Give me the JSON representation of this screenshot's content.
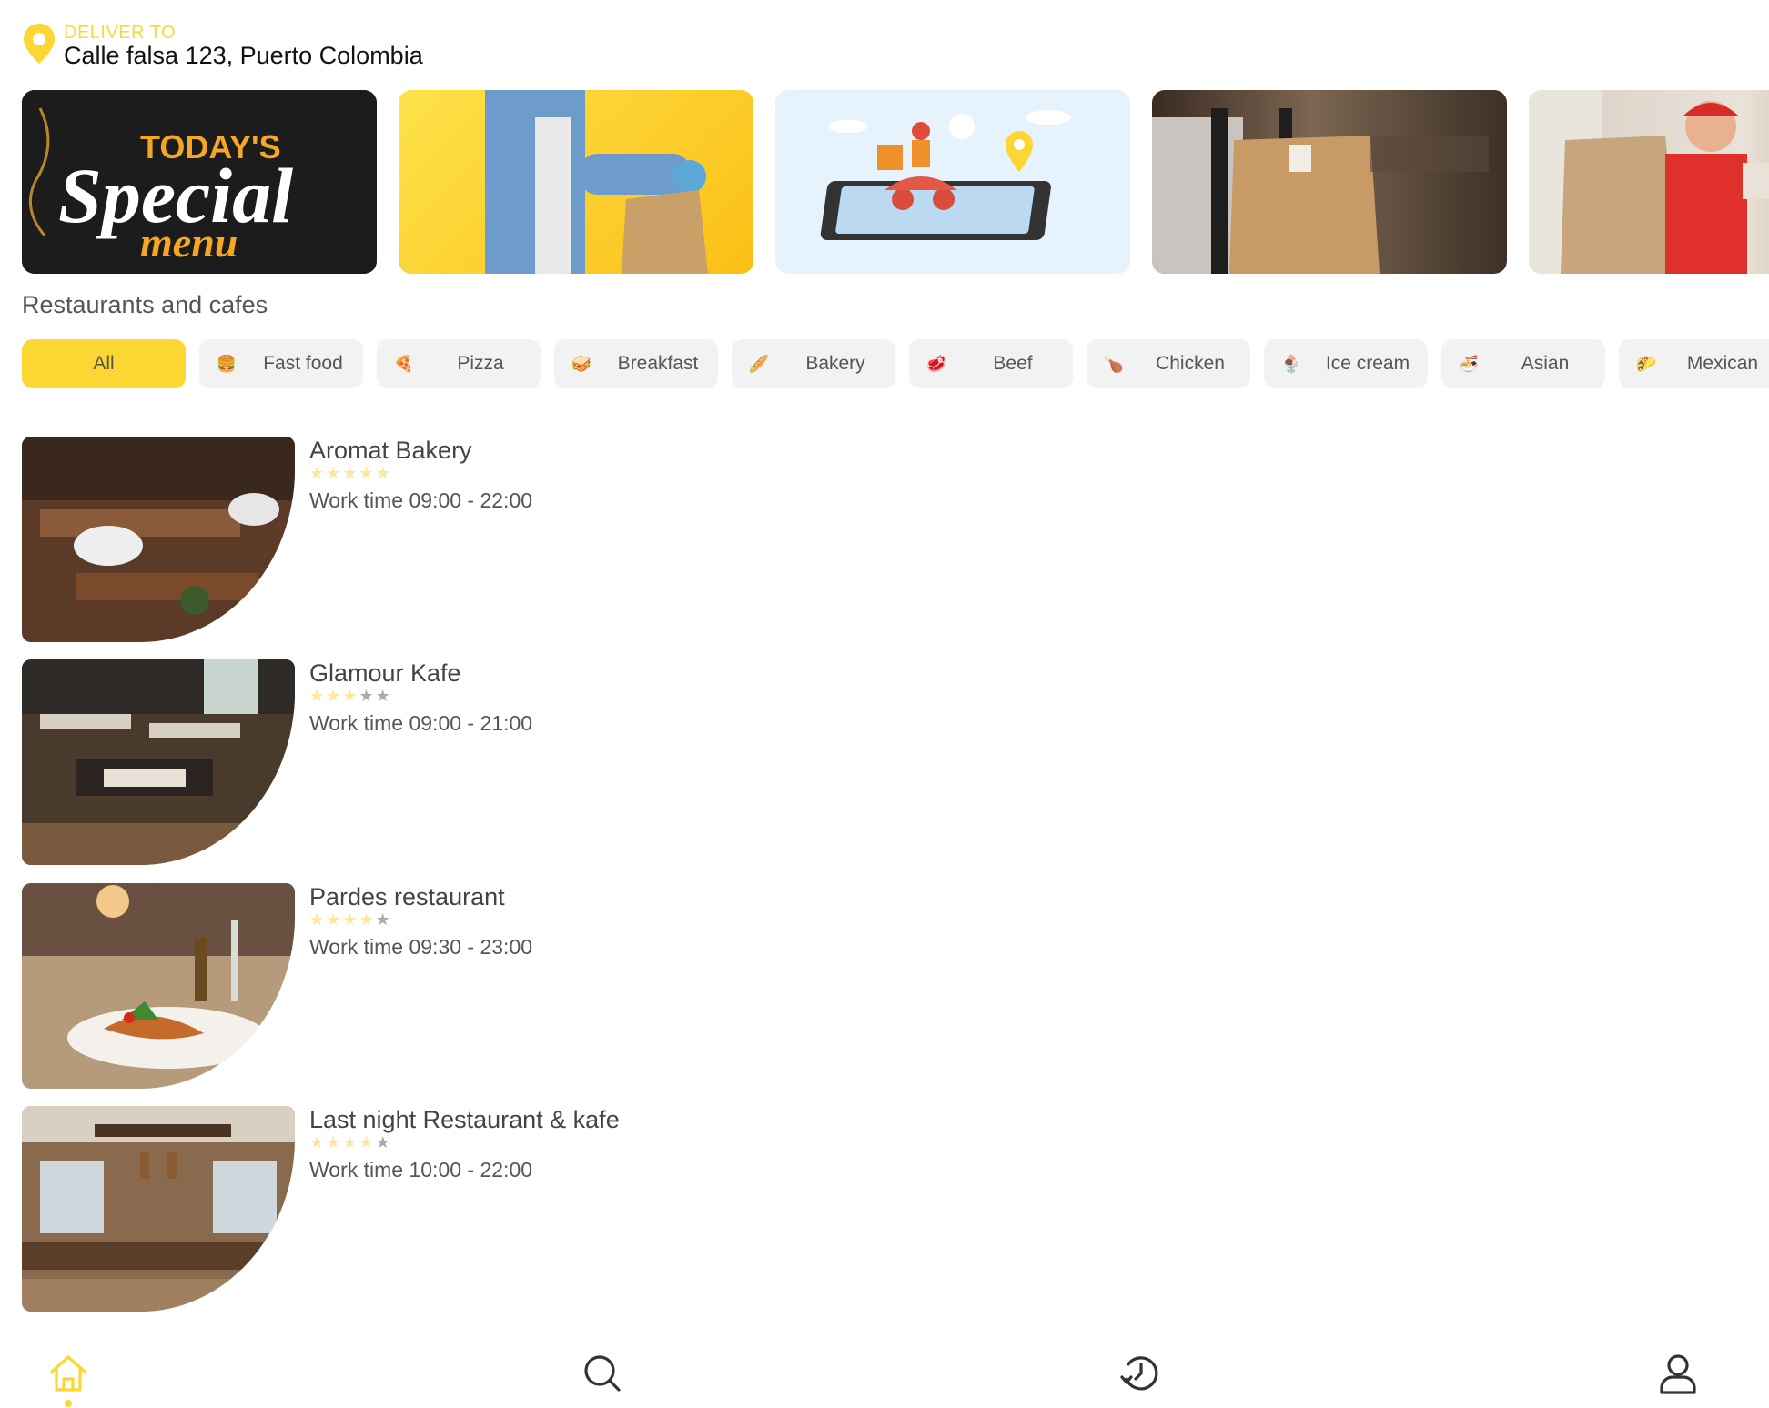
{
  "header": {
    "deliver_label": "DELIVER TO",
    "address": "Calle falsa 123, Puerto Colombia"
  },
  "banners": [
    {
      "name": "todays-special-menu",
      "line1": "TODAY'S",
      "line2": "Special",
      "line3": "menu"
    },
    {
      "name": "delivery-man-bag"
    },
    {
      "name": "scooter-delivery-map"
    },
    {
      "name": "person-holding-paper-bag"
    },
    {
      "name": "courier-red-cap"
    }
  ],
  "section_title": "Restaurants and cafes",
  "categories": [
    {
      "label": "All",
      "icon": "",
      "active": true
    },
    {
      "label": "Fast food",
      "icon": "🍔"
    },
    {
      "label": "Pizza",
      "icon": "🍕"
    },
    {
      "label": "Breakfast",
      "icon": "🥪"
    },
    {
      "label": "Bakery",
      "icon": "🥖"
    },
    {
      "label": "Beef",
      "icon": "🥩"
    },
    {
      "label": "Chicken",
      "icon": "🍗"
    },
    {
      "label": "Ice cream",
      "icon": "🍨"
    },
    {
      "label": "Asian",
      "icon": "🍜"
    },
    {
      "label": "Mexican",
      "icon": "🌮"
    }
  ],
  "restaurants": [
    {
      "name": "Aromat Bakery",
      "rating": 5,
      "work_time": "Work time 09:00 - 22:00"
    },
    {
      "name": "Glamour Kafe",
      "rating": 3,
      "work_time": "Work time 09:00 - 21:00"
    },
    {
      "name": "Pardes restaurant",
      "rating": 4,
      "work_time": "Work time 09:30 - 23:00"
    },
    {
      "name": "Last night Restaurant & kafe",
      "rating": 4,
      "work_time": "Work time 10:00 - 22:00"
    }
  ],
  "nav": [
    {
      "name": "home",
      "icon": "home-icon",
      "active": true
    },
    {
      "name": "search",
      "icon": "search-icon"
    },
    {
      "name": "history",
      "icon": "history-icon"
    },
    {
      "name": "profile",
      "icon": "user-icon"
    }
  ],
  "colors": {
    "accent": "#fcd734",
    "star_on": "#fce79a",
    "star_off": "#aaaaaa",
    "chip_bg": "#f2f2f2"
  }
}
